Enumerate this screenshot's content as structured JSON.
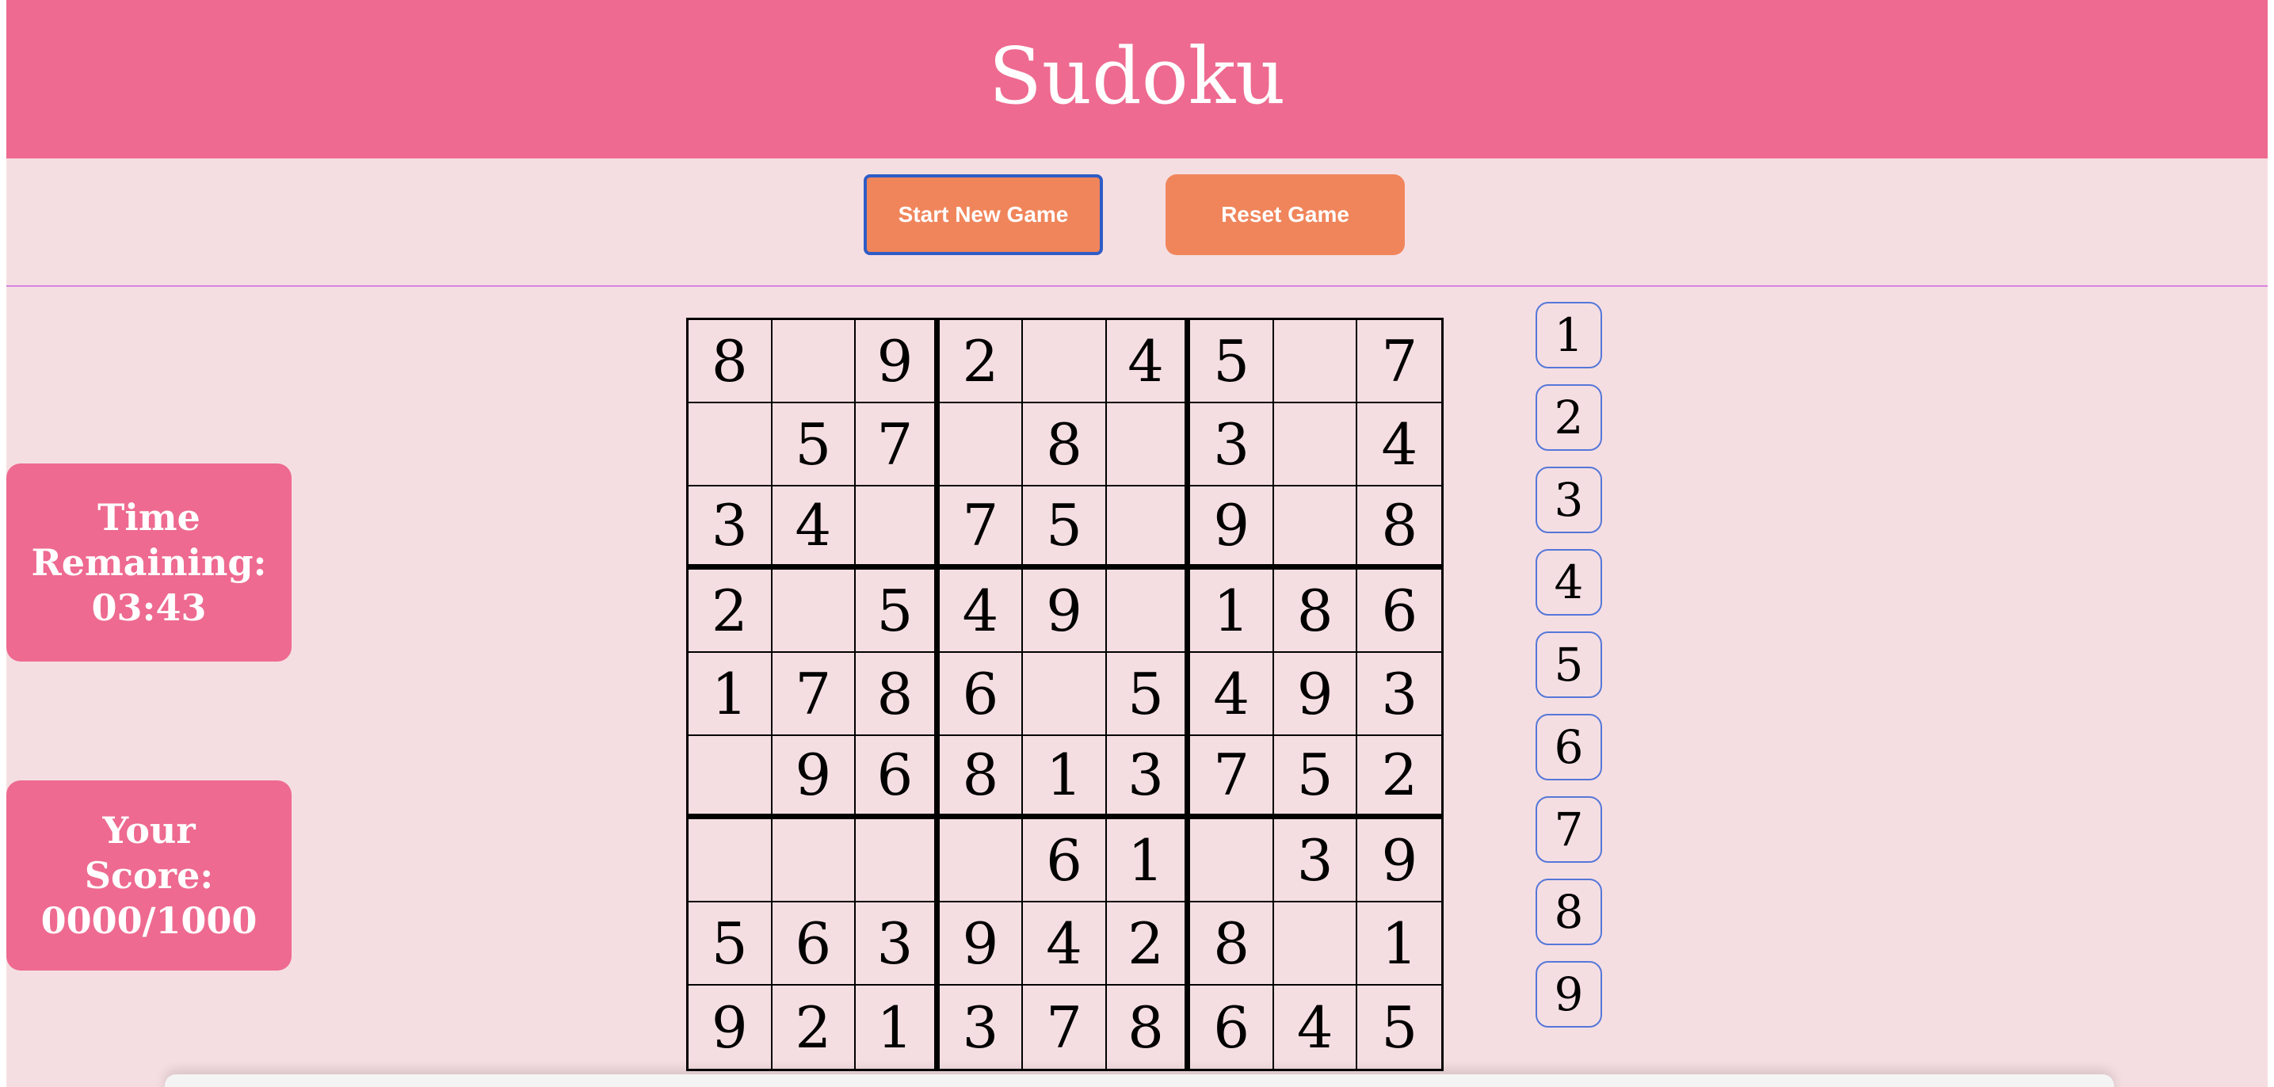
{
  "header": {
    "title": "Sudoku",
    "background": "#ee6a90"
  },
  "controls": {
    "new_game_label": "Start New Game",
    "reset_label": "Reset Game",
    "button_color": "#f0855b",
    "focus_ring_color": "#2f5cc6"
  },
  "status": {
    "time": {
      "line1": "Time",
      "line2": "Remaining:",
      "value": "03:43"
    },
    "score": {
      "line1": "Your",
      "line2": "Score:",
      "value": "0000/1000"
    }
  },
  "board": {
    "rows": [
      [
        "8",
        "",
        "9",
        "2",
        "",
        "4",
        "5",
        "",
        "7"
      ],
      [
        "",
        "5",
        "7",
        "",
        "8",
        "",
        "3",
        "",
        "4"
      ],
      [
        "3",
        "4",
        "",
        "7",
        "5",
        "",
        "9",
        "",
        "8"
      ],
      [
        "2",
        "",
        "5",
        "4",
        "9",
        "",
        "1",
        "8",
        "6"
      ],
      [
        "1",
        "7",
        "8",
        "6",
        "",
        "5",
        "4",
        "9",
        "3"
      ],
      [
        "",
        "9",
        "6",
        "8",
        "1",
        "3",
        "7",
        "5",
        "2"
      ],
      [
        "",
        "",
        "",
        "",
        "6",
        "1",
        "",
        "3",
        "9"
      ],
      [
        "5",
        "6",
        "3",
        "9",
        "4",
        "2",
        "8",
        "",
        "1"
      ],
      [
        "9",
        "2",
        "1",
        "3",
        "7",
        "8",
        "6",
        "4",
        "5"
      ]
    ]
  },
  "number_picker": [
    "1",
    "2",
    "3",
    "4",
    "5",
    "6",
    "7",
    "8",
    "9"
  ],
  "colors": {
    "page_background": "#f5dee2",
    "accent_pink": "#ee6a90",
    "divider": "#d884e0",
    "picker_border": "#5577d8"
  }
}
